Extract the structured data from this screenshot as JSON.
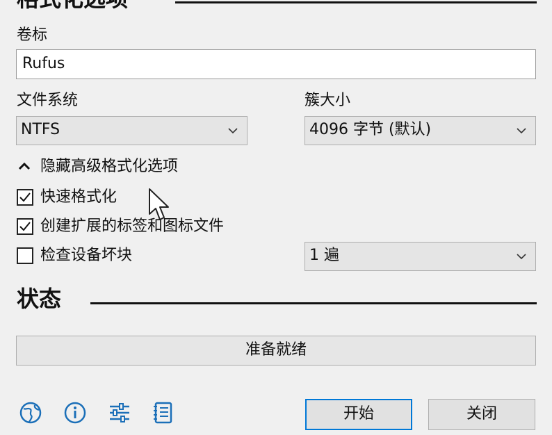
{
  "format_section": {
    "title": "格式化选项"
  },
  "volume_label": {
    "label": "卷标",
    "value": "Rufus"
  },
  "filesystem": {
    "label": "文件系统",
    "value": "NTFS"
  },
  "cluster_size": {
    "label": "簇大小",
    "value": "4096 字节 (默认)"
  },
  "advanced_toggle": {
    "label": "隐藏高级格式化选项"
  },
  "options": {
    "quick_format": {
      "label": "快速格式化",
      "checked": true
    },
    "extended_label": {
      "label": "创建扩展的标签和图标文件",
      "checked": true
    },
    "bad_blocks": {
      "label": "检查设备坏块",
      "checked": false
    }
  },
  "passes": {
    "value": "1 遍"
  },
  "status_section": {
    "title": "状态"
  },
  "status": {
    "text": "准备就绪"
  },
  "footer": {
    "start_label": "开始",
    "close_label": "关闭",
    "icons": [
      "globe-icon",
      "info-icon",
      "settings-sliders-icon",
      "log-icon"
    ]
  },
  "colors": {
    "primary_border": "#0078d7",
    "background": "#f0f0f0"
  }
}
